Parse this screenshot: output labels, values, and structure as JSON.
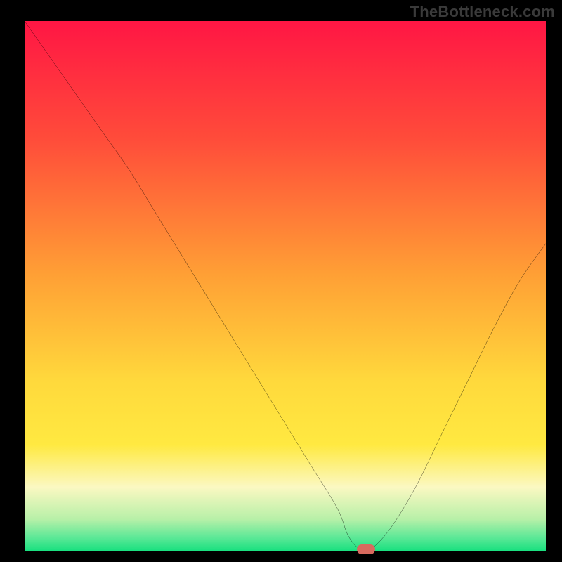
{
  "attribution": "TheBottleneck.com",
  "colors": {
    "bg_black": "#000000",
    "grad_top": "#ff1644",
    "grad_yellow": "#ffe941",
    "grad_cream": "#fbf8c2",
    "grad_green": "#19e07f",
    "curve": "#000000",
    "marker": "#d86a5e",
    "attribution_text": "#3a3a3a"
  },
  "chart_data": {
    "type": "line",
    "title": "",
    "xlabel": "",
    "ylabel": "",
    "xlim": [
      0,
      100
    ],
    "ylim": [
      0,
      100
    ],
    "x": [
      0,
      5,
      10,
      15,
      20,
      25,
      30,
      35,
      40,
      45,
      50,
      55,
      60,
      62,
      64,
      66,
      70,
      75,
      80,
      85,
      90,
      95,
      100
    ],
    "values": [
      100,
      93,
      86,
      79,
      72,
      64,
      56,
      48,
      40,
      32,
      24,
      16,
      8,
      3,
      0.5,
      0,
      4,
      12,
      22,
      32,
      42,
      51,
      58
    ],
    "optimum_x": 65.5,
    "optimum_y": 0,
    "annotations": [],
    "legend": []
  }
}
